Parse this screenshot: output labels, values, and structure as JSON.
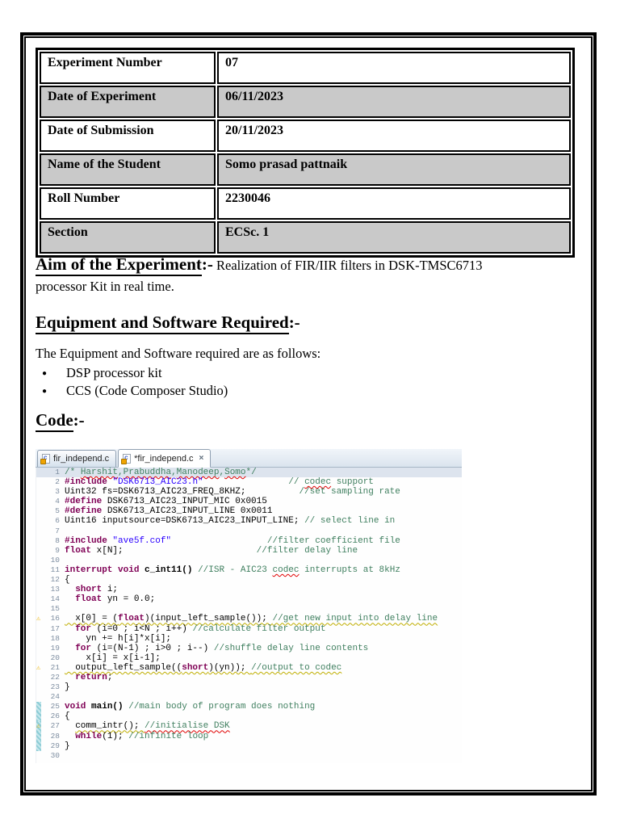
{
  "page": {
    "background": "#ffffff",
    "border_color": "#000000"
  },
  "info_table": {
    "alt_row_color": "#c9c9c9",
    "rows": [
      {
        "label": "Experiment Number",
        "value": "07"
      },
      {
        "label": "Date of Experiment",
        "value": "06/11/2023"
      },
      {
        "label": "Date of Submission",
        "value": "20/11/2023"
      },
      {
        "label": "Name of the Student",
        "value": "Somo prasad pattnaik"
      },
      {
        "label": "Roll Number",
        "value": "2230046"
      },
      {
        "label": "Section",
        "value": "ECSc. 1"
      }
    ]
  },
  "sections": {
    "aim": {
      "heading": "Aim of the Experiment",
      "sep": ":-",
      "text": " Realization of FIR/IIR filters in DSK-TMSC6713",
      "text2": "processor Kit in real time."
    },
    "equipment": {
      "heading": "Equipment and Software Required",
      "sep": ":-",
      "intro": "The Equipment and Software required are as follows:",
      "bullet_glyph": "●",
      "items": [
        "DSP processor kit",
        "CCS (Code Composer Studio)"
      ]
    },
    "code": {
      "heading": "Code",
      "sep": ":-"
    }
  },
  "editor": {
    "tabs": [
      {
        "label": "fir_independ.c",
        "active": false
      },
      {
        "label": "*fir_independ.c",
        "active": true
      }
    ],
    "close_glyph": "×",
    "file_icon_letter": "c",
    "warning_glyph": "⚠",
    "colors": {
      "keyword": "#7f0055",
      "string": "#2a00ff",
      "comment": "#3f7f5f",
      "line_number": "#7d8da0",
      "selected_line": "#dde4ee",
      "change_bar": "#8ecdd6",
      "warning": "#e9b200",
      "spell_squiggle": "#e00000",
      "warn_squiggle": "#bfae00",
      "table_alt_row": "#c9c9c9"
    },
    "lines": [
      {
        "n": 1,
        "sel": true,
        "seg": [
          [
            "/* ",
            "cm"
          ],
          [
            "Harshit",
            "cm sp"
          ],
          [
            ",",
            "cm"
          ],
          [
            "Prabuddha",
            "cm sp"
          ],
          [
            ",",
            "cm"
          ],
          [
            "Manodeep",
            "cm sp"
          ],
          [
            ",",
            "cm"
          ],
          [
            "Somo",
            "cm sp"
          ],
          [
            "*/",
            "cm"
          ]
        ]
      },
      {
        "n": 2,
        "seg": [
          [
            "#include",
            "k"
          ],
          [
            " ",
            "p"
          ],
          [
            "\"DSK6713_AIC23.h\"",
            "s"
          ],
          [
            "                ",
            "p"
          ],
          [
            "// ",
            "cm"
          ],
          [
            "codec",
            "cm sp"
          ],
          [
            " support",
            "cm"
          ]
        ]
      },
      {
        "n": 3,
        "seg": [
          [
            "Uint32 fs=DSK6713_AIC23_FREQ_8KHZ;",
            "p"
          ],
          [
            "          ",
            "p"
          ],
          [
            "//set sampling rate",
            "cm"
          ]
        ]
      },
      {
        "n": 4,
        "seg": [
          [
            "#define",
            "k"
          ],
          [
            " DSK6713_AIC23_INPUT_MIC 0x0015",
            "p"
          ]
        ]
      },
      {
        "n": 5,
        "seg": [
          [
            "#define",
            "k"
          ],
          [
            " DSK6713_AIC23_INPUT_LINE 0x0011",
            "p"
          ]
        ]
      },
      {
        "n": 6,
        "seg": [
          [
            "Uint16 inputsource=DSK6713_AIC23_INPUT_LINE; ",
            "p"
          ],
          [
            "// select line in",
            "cm"
          ]
        ]
      },
      {
        "n": 7,
        "seg": []
      },
      {
        "n": 8,
        "seg": [
          [
            "#include",
            "k"
          ],
          [
            " ",
            "p"
          ],
          [
            "\"ave5f.cof\"",
            "s"
          ],
          [
            "                  ",
            "p"
          ],
          [
            "//filter coefficient file",
            "cm"
          ]
        ]
      },
      {
        "n": 9,
        "seg": [
          [
            "float",
            "k"
          ],
          [
            " x[N];",
            "p"
          ],
          [
            "                         ",
            "p"
          ],
          [
            "//filter delay line",
            "cm"
          ]
        ]
      },
      {
        "n": 10,
        "seg": []
      },
      {
        "n": 11,
        "seg": [
          [
            "interrupt",
            "k"
          ],
          [
            " ",
            "p"
          ],
          [
            "void",
            "k"
          ],
          [
            " ",
            "p"
          ],
          [
            "c_int11()",
            "b"
          ],
          [
            " ",
            "p"
          ],
          [
            "//ISR - AIC23 ",
            "cm"
          ],
          [
            "codec",
            "cm sp"
          ],
          [
            " interrupts at 8kHz",
            "cm"
          ]
        ]
      },
      {
        "n": 12,
        "seg": [
          [
            "{",
            "p"
          ]
        ]
      },
      {
        "n": 13,
        "seg": [
          [
            "  ",
            "p"
          ],
          [
            "short",
            "k"
          ],
          [
            " i;",
            "p"
          ]
        ]
      },
      {
        "n": 14,
        "seg": [
          [
            "  ",
            "p"
          ],
          [
            "float",
            "k"
          ],
          [
            " yn = 0.0;",
            "p"
          ]
        ]
      },
      {
        "n": 15,
        "seg": []
      },
      {
        "n": 16,
        "warn": true,
        "seg": [
          [
            "  x[0] = (",
            "p w"
          ],
          [
            "float",
            "k w"
          ],
          [
            ")(input_left_sample()); ",
            "p w"
          ],
          [
            "//get new input into delay line",
            "cm w"
          ]
        ]
      },
      {
        "n": 17,
        "seg": [
          [
            "  ",
            "p"
          ],
          [
            "for",
            "k"
          ],
          [
            " (i=0 ; i<N ; i++) ",
            "p"
          ],
          [
            "//calculate filter output",
            "cm"
          ]
        ]
      },
      {
        "n": 18,
        "seg": [
          [
            "    yn += h[i]*x[i];",
            "p"
          ]
        ]
      },
      {
        "n": 19,
        "seg": [
          [
            "  ",
            "p"
          ],
          [
            "for",
            "k"
          ],
          [
            " (i=(N-1) ; i>0 ; i--) ",
            "p"
          ],
          [
            "//shuffle delay line contents",
            "cm"
          ]
        ]
      },
      {
        "n": 20,
        "seg": [
          [
            "    x[i] = x[i-1];",
            "p"
          ]
        ]
      },
      {
        "n": 21,
        "warn": true,
        "seg": [
          [
            "  output_left_sample((",
            "p w"
          ],
          [
            "short",
            "k w"
          ],
          [
            ")(yn)); ",
            "p w"
          ],
          [
            "//output to codec",
            "cm w"
          ]
        ]
      },
      {
        "n": 22,
        "seg": [
          [
            "  ",
            "p"
          ],
          [
            "return",
            "k"
          ],
          [
            ";",
            "p"
          ]
        ]
      },
      {
        "n": 23,
        "seg": [
          [
            "}",
            "p"
          ]
        ]
      },
      {
        "n": 24,
        "seg": []
      },
      {
        "n": 25,
        "bar": true,
        "seg": [
          [
            "void",
            "k"
          ],
          [
            " ",
            "p"
          ],
          [
            "main()",
            "b"
          ],
          [
            " ",
            "p"
          ],
          [
            "//main body of program does nothing",
            "cm"
          ]
        ]
      },
      {
        "n": 26,
        "bar": true,
        "seg": [
          [
            "{",
            "p"
          ]
        ]
      },
      {
        "n": 27,
        "bar": true,
        "warn": true,
        "seg": [
          [
            "  ",
            "p"
          ],
          [
            "comm_intr(); ",
            "p w"
          ],
          [
            "//initialise DSK",
            "cm sp"
          ]
        ]
      },
      {
        "n": 28,
        "bar": true,
        "seg": [
          [
            "  ",
            "p"
          ],
          [
            "while",
            "k"
          ],
          [
            "(1); ",
            "p"
          ],
          [
            "//infinite loop",
            "cm"
          ]
        ]
      },
      {
        "n": 29,
        "bar": true,
        "seg": [
          [
            "}",
            "p"
          ]
        ]
      },
      {
        "n": 30,
        "seg": []
      }
    ]
  }
}
